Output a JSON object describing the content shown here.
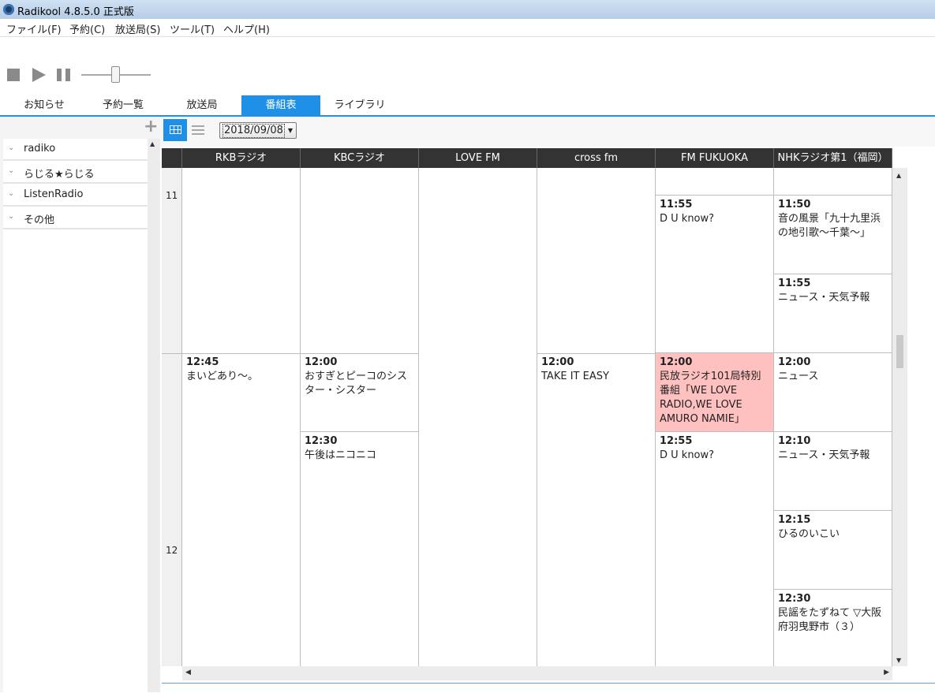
{
  "window": {
    "title": "Radikool 4.8.5.0 正式版"
  },
  "menu": [
    "ファイル(F)",
    "予約(C)",
    "放送局(S)",
    "ツール(T)",
    "ヘルプ(H)"
  ],
  "player": {
    "volume_fraction": 0.5
  },
  "tabs": [
    "お知らせ",
    "予約一覧",
    "放送局",
    "番組表",
    "ライブラリ"
  ],
  "active_tab": "番組表",
  "sidebar": {
    "items": [
      "radiko",
      "らじる★らじる",
      "ListenRadio",
      "その他"
    ]
  },
  "toolbar": {
    "date": "2018/09/08"
  },
  "guide": {
    "hours": [
      "11",
      "12"
    ],
    "stations": [
      "RKBラジオ",
      "KBCラジオ",
      "LOVE FM",
      "cross fm",
      "FM FUKUOKA",
      "NHKラジオ第1（福岡）"
    ],
    "programs": {
      "rkb": [
        {
          "time": "12:45",
          "title": "まいどあり〜。"
        }
      ],
      "kbc": [
        {
          "time": "12:00",
          "title": "おすぎとピーコのシスター・シスター"
        },
        {
          "time": "12:30",
          "title": "午後はニコニコ"
        }
      ],
      "crossfm": [
        {
          "time": "12:00",
          "title": "TAKE IT EASY"
        }
      ],
      "fmfukuoka": [
        {
          "time": "11:55",
          "title": "D U know?"
        },
        {
          "time": "12:00",
          "title": "民放ラジオ101局特別番組「WE LOVE RADIO,WE LOVE AMURO NAMIE」",
          "highlight": true
        },
        {
          "time": "12:55",
          "title": "D U know?"
        }
      ],
      "nhk": [
        {
          "time": "11:50",
          "title": "音の風景「九十九里浜の地引歌〜千葉〜」"
        },
        {
          "time": "11:55",
          "title": "ニュース・天気予報"
        },
        {
          "time": "12:00",
          "title": "ニュース"
        },
        {
          "time": "12:10",
          "title": "ニュース・天気予報"
        },
        {
          "time": "12:15",
          "title": "ひるのいこい"
        },
        {
          "time": "12:30",
          "title": "民謡をたずねて ▽大阪府羽曳野市（３）"
        }
      ]
    }
  },
  "colors": {
    "accent": "#1e90e8",
    "highlight": "#ffc0c0",
    "header_bg": "#333333"
  }
}
